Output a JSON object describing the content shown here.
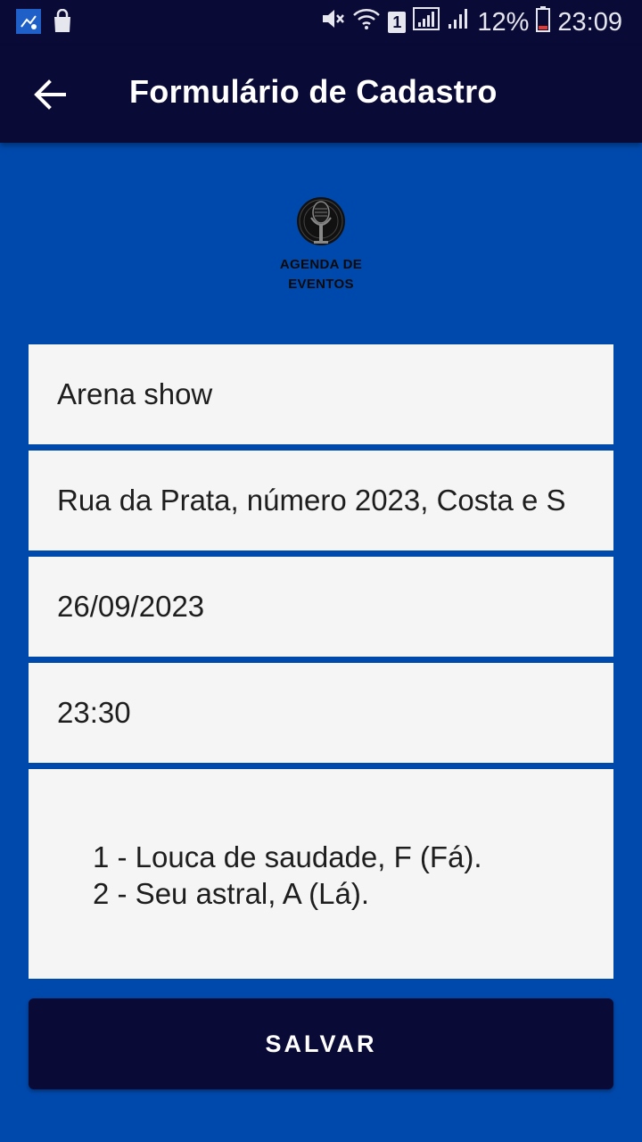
{
  "status_bar": {
    "battery": "12%",
    "time": "23:09",
    "sim_badge": "1"
  },
  "app_bar": {
    "title": "Formulário de Cadastro"
  },
  "logo": {
    "line1": "AGENDA DE",
    "line2": "EVENTOS"
  },
  "form": {
    "name_value": "Arena show",
    "address_value": "Rua da Prata, número 2023, Costa e S",
    "date_value": "26/09/2023",
    "time_value": "23:30",
    "notes_line1": "1 - Louca de saudade, F (Fá).",
    "notes_line2": "2 - Seu astral, A (Lá)."
  },
  "save_button": {
    "label": "SALVAR"
  },
  "colors": {
    "background": "#0049ac",
    "app_bar": "#0a0a37",
    "field": "#f5f5f5"
  }
}
